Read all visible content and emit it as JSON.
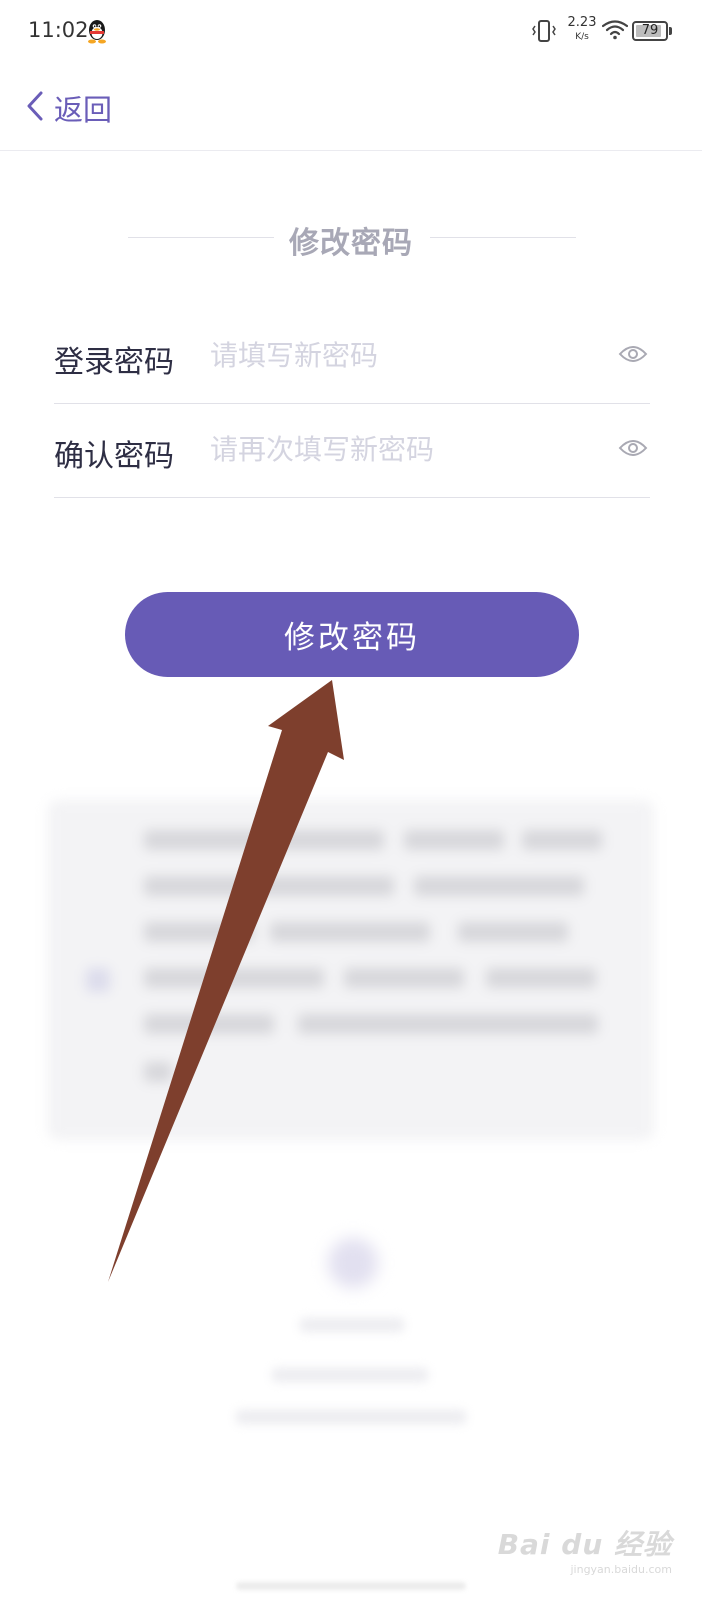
{
  "status_bar": {
    "time": "11:02",
    "net_speed_value": "2.23",
    "net_speed_unit": "K/s",
    "battery_level": "79",
    "icons": [
      "qq-icon",
      "vibrate-icon",
      "wifi-icon",
      "battery-icon"
    ]
  },
  "nav": {
    "back_label": "返回",
    "back_icon": "chevron-left-icon"
  },
  "form": {
    "title": "修改密码",
    "fields": [
      {
        "label": "登录密码",
        "placeholder": "请填写新密码",
        "value": "",
        "icon": "eye-icon"
      },
      {
        "label": "确认密码",
        "placeholder": "请再次填写新密码",
        "value": "",
        "icon": "eye-icon"
      }
    ],
    "submit_label": "修改密码"
  },
  "colors": {
    "accent": "#675bb6",
    "back_text": "#6a5db8",
    "label_text": "#2e2e44",
    "placeholder": "#d4d4e0",
    "annotation_arrow": "#7e3f2d"
  },
  "watermark": {
    "main": "Bai du 经验",
    "sub": "jingyan.baidu.com"
  }
}
